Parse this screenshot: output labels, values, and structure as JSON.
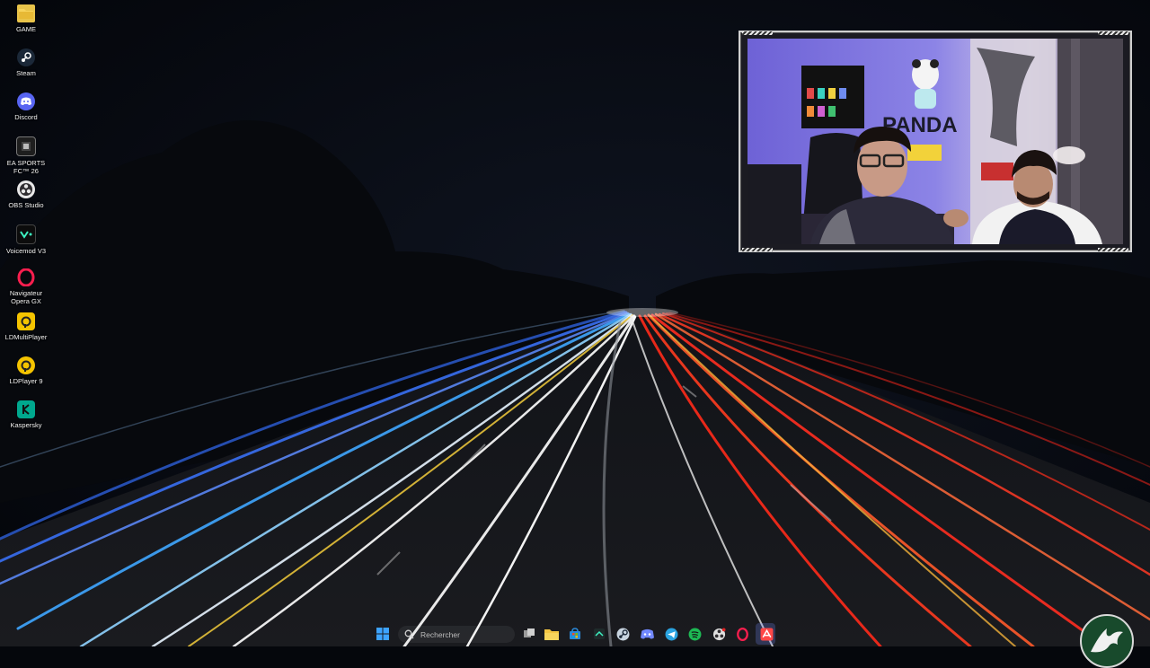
{
  "desktop": {
    "icons": [
      {
        "label": "GAME",
        "icon": "folder-icon",
        "color": "#e8c34a"
      },
      {
        "label": "Steam",
        "icon": "steam-icon",
        "color": "#1b2838"
      },
      {
        "label": "Discord",
        "icon": "discord-icon",
        "color": "#5865f2"
      },
      {
        "label": "EA SPORTS FC™ 26",
        "icon": "ea-fc-icon",
        "color": "#1e1e1e"
      },
      {
        "label": "OBS Studio",
        "icon": "obs-icon",
        "color": "#302e31"
      },
      {
        "label": "Voicemod V3",
        "icon": "voicemod-icon",
        "color": "#0c0c0c"
      },
      {
        "label": "Navigateur Opera GX",
        "icon": "opera-gx-icon",
        "color": "#fa1e4e"
      },
      {
        "label": "LDMultiPlayer",
        "icon": "ldmultiplayer-icon",
        "color": "#f5c400"
      },
      {
        "label": "LDPlayer 9",
        "icon": "ldplayer-icon",
        "color": "#f5c400"
      },
      {
        "label": "Kaspersky",
        "icon": "kaspersky-icon",
        "color": "#00a88e"
      }
    ]
  },
  "taskbar": {
    "search_placeholder": "Rechercher",
    "items": [
      {
        "icon": "windows-start-icon",
        "color": "#3da3ff"
      },
      {
        "icon": "task-view-icon",
        "color": "#9a9a9a"
      },
      {
        "icon": "file-explorer-icon",
        "color": "#f4c542"
      },
      {
        "icon": "microsoft-store-icon",
        "color": "#2b89d8"
      },
      {
        "icon": "app-icon",
        "color": "#1f2b2b"
      },
      {
        "icon": "steam-icon",
        "color": "#1b2838"
      },
      {
        "icon": "discord-icon",
        "color": "#5865f2"
      },
      {
        "icon": "telegram-icon",
        "color": "#2aa3e0"
      },
      {
        "icon": "spotify-icon",
        "color": "#1db954"
      },
      {
        "icon": "obs-icon",
        "color": "#3a3a3a"
      },
      {
        "icon": "opera-gx-icon",
        "color": "#fa1e4e"
      },
      {
        "icon": "ea-app-icon",
        "color": "#ff4747"
      }
    ]
  },
  "webcam": {
    "sign_text": "PANDA"
  }
}
